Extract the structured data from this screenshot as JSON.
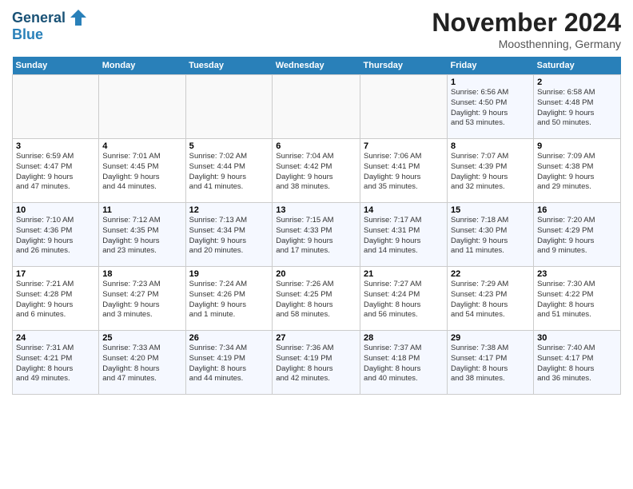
{
  "header": {
    "logo_line1": "General",
    "logo_line2": "Blue",
    "month_title": "November 2024",
    "location": "Moosthenning, Germany"
  },
  "days_of_week": [
    "Sunday",
    "Monday",
    "Tuesday",
    "Wednesday",
    "Thursday",
    "Friday",
    "Saturday"
  ],
  "weeks": [
    [
      {
        "day": "",
        "info": ""
      },
      {
        "day": "",
        "info": ""
      },
      {
        "day": "",
        "info": ""
      },
      {
        "day": "",
        "info": ""
      },
      {
        "day": "",
        "info": ""
      },
      {
        "day": "1",
        "info": "Sunrise: 6:56 AM\nSunset: 4:50 PM\nDaylight: 9 hours\nand 53 minutes."
      },
      {
        "day": "2",
        "info": "Sunrise: 6:58 AM\nSunset: 4:48 PM\nDaylight: 9 hours\nand 50 minutes."
      }
    ],
    [
      {
        "day": "3",
        "info": "Sunrise: 6:59 AM\nSunset: 4:47 PM\nDaylight: 9 hours\nand 47 minutes."
      },
      {
        "day": "4",
        "info": "Sunrise: 7:01 AM\nSunset: 4:45 PM\nDaylight: 9 hours\nand 44 minutes."
      },
      {
        "day": "5",
        "info": "Sunrise: 7:02 AM\nSunset: 4:44 PM\nDaylight: 9 hours\nand 41 minutes."
      },
      {
        "day": "6",
        "info": "Sunrise: 7:04 AM\nSunset: 4:42 PM\nDaylight: 9 hours\nand 38 minutes."
      },
      {
        "day": "7",
        "info": "Sunrise: 7:06 AM\nSunset: 4:41 PM\nDaylight: 9 hours\nand 35 minutes."
      },
      {
        "day": "8",
        "info": "Sunrise: 7:07 AM\nSunset: 4:39 PM\nDaylight: 9 hours\nand 32 minutes."
      },
      {
        "day": "9",
        "info": "Sunrise: 7:09 AM\nSunset: 4:38 PM\nDaylight: 9 hours\nand 29 minutes."
      }
    ],
    [
      {
        "day": "10",
        "info": "Sunrise: 7:10 AM\nSunset: 4:36 PM\nDaylight: 9 hours\nand 26 minutes."
      },
      {
        "day": "11",
        "info": "Sunrise: 7:12 AM\nSunset: 4:35 PM\nDaylight: 9 hours\nand 23 minutes."
      },
      {
        "day": "12",
        "info": "Sunrise: 7:13 AM\nSunset: 4:34 PM\nDaylight: 9 hours\nand 20 minutes."
      },
      {
        "day": "13",
        "info": "Sunrise: 7:15 AM\nSunset: 4:33 PM\nDaylight: 9 hours\nand 17 minutes."
      },
      {
        "day": "14",
        "info": "Sunrise: 7:17 AM\nSunset: 4:31 PM\nDaylight: 9 hours\nand 14 minutes."
      },
      {
        "day": "15",
        "info": "Sunrise: 7:18 AM\nSunset: 4:30 PM\nDaylight: 9 hours\nand 11 minutes."
      },
      {
        "day": "16",
        "info": "Sunrise: 7:20 AM\nSunset: 4:29 PM\nDaylight: 9 hours\nand 9 minutes."
      }
    ],
    [
      {
        "day": "17",
        "info": "Sunrise: 7:21 AM\nSunset: 4:28 PM\nDaylight: 9 hours\nand 6 minutes."
      },
      {
        "day": "18",
        "info": "Sunrise: 7:23 AM\nSunset: 4:27 PM\nDaylight: 9 hours\nand 3 minutes."
      },
      {
        "day": "19",
        "info": "Sunrise: 7:24 AM\nSunset: 4:26 PM\nDaylight: 9 hours\nand 1 minute."
      },
      {
        "day": "20",
        "info": "Sunrise: 7:26 AM\nSunset: 4:25 PM\nDaylight: 8 hours\nand 58 minutes."
      },
      {
        "day": "21",
        "info": "Sunrise: 7:27 AM\nSunset: 4:24 PM\nDaylight: 8 hours\nand 56 minutes."
      },
      {
        "day": "22",
        "info": "Sunrise: 7:29 AM\nSunset: 4:23 PM\nDaylight: 8 hours\nand 54 minutes."
      },
      {
        "day": "23",
        "info": "Sunrise: 7:30 AM\nSunset: 4:22 PM\nDaylight: 8 hours\nand 51 minutes."
      }
    ],
    [
      {
        "day": "24",
        "info": "Sunrise: 7:31 AM\nSunset: 4:21 PM\nDaylight: 8 hours\nand 49 minutes."
      },
      {
        "day": "25",
        "info": "Sunrise: 7:33 AM\nSunset: 4:20 PM\nDaylight: 8 hours\nand 47 minutes."
      },
      {
        "day": "26",
        "info": "Sunrise: 7:34 AM\nSunset: 4:19 PM\nDaylight: 8 hours\nand 44 minutes."
      },
      {
        "day": "27",
        "info": "Sunrise: 7:36 AM\nSunset: 4:19 PM\nDaylight: 8 hours\nand 42 minutes."
      },
      {
        "day": "28",
        "info": "Sunrise: 7:37 AM\nSunset: 4:18 PM\nDaylight: 8 hours\nand 40 minutes."
      },
      {
        "day": "29",
        "info": "Sunrise: 7:38 AM\nSunset: 4:17 PM\nDaylight: 8 hours\nand 38 minutes."
      },
      {
        "day": "30",
        "info": "Sunrise: 7:40 AM\nSunset: 4:17 PM\nDaylight: 8 hours\nand 36 minutes."
      }
    ]
  ]
}
